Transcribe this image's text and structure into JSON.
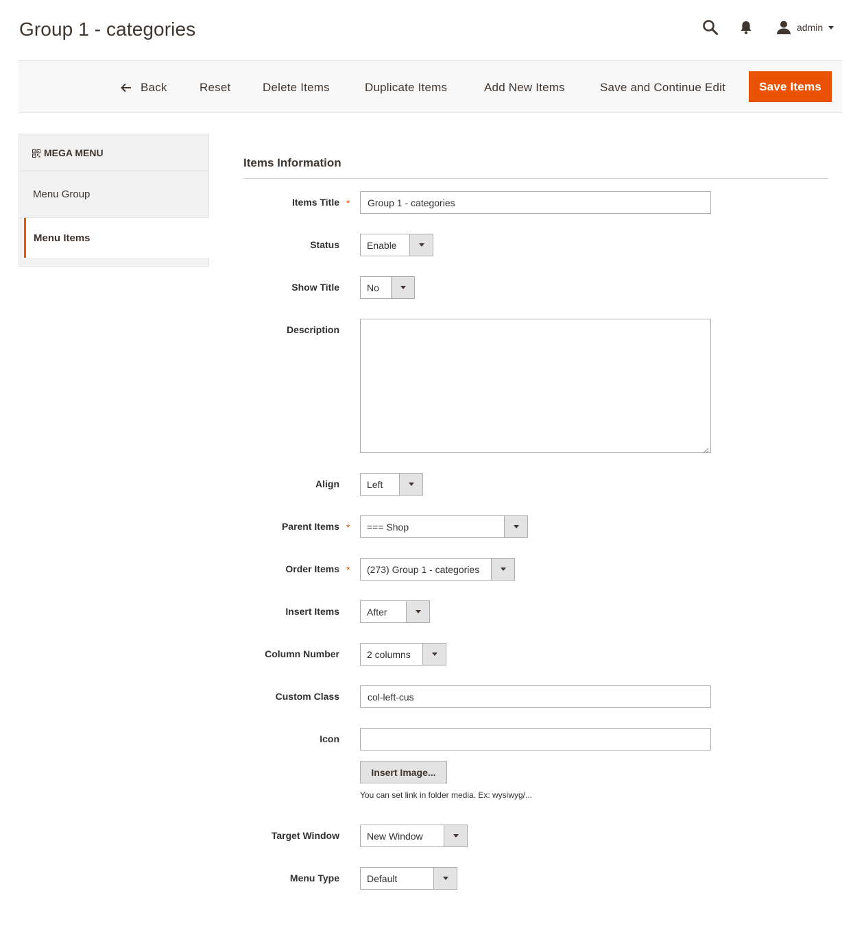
{
  "header": {
    "title": "Group 1 - categories",
    "user_name": "admin",
    "icons": {
      "search": "search-icon",
      "notifications": "bell-icon",
      "user": "user-icon"
    }
  },
  "toolbar": {
    "back_label": "Back",
    "reset_label": "Reset",
    "delete_label": "Delete Items",
    "duplicate_label": "Duplicate Items",
    "add_label": "Add New Items",
    "save_continue_label": "Save and Continue Edit",
    "save_label": "Save Items"
  },
  "sidebar": {
    "title": "MEGA MENU",
    "items": [
      {
        "label": "Menu Group",
        "active": false
      },
      {
        "label": "Menu Items",
        "active": true
      }
    ]
  },
  "form": {
    "section_title": "Items Information",
    "fields": {
      "items_title": {
        "label": "Items Title",
        "value": "Group 1 - categories",
        "required": true
      },
      "status": {
        "label": "Status",
        "value": "Enable"
      },
      "show_title": {
        "label": "Show Title",
        "value": "No"
      },
      "description": {
        "label": "Description",
        "value": ""
      },
      "align": {
        "label": "Align",
        "value": "Left"
      },
      "parent_items": {
        "label": "Parent Items",
        "value": "=== Shop",
        "required": true
      },
      "order_items": {
        "label": "Order Items",
        "value": "(273) Group 1 - categories",
        "required": true
      },
      "insert_items": {
        "label": "Insert Items",
        "value": "After"
      },
      "column_number": {
        "label": "Column Number",
        "value": "2 columns"
      },
      "custom_class": {
        "label": "Custom Class",
        "value": "col-left-cus"
      },
      "icon": {
        "label": "Icon",
        "value": "",
        "insert_button": "Insert Image...",
        "note": "You can set link in folder media. Ex: wysiwyg/..."
      },
      "target_window": {
        "label": "Target Window",
        "value": "New Window"
      },
      "menu_type": {
        "label": "Menu Type",
        "value": "Default"
      }
    },
    "required_mark": "*"
  },
  "colors": {
    "accent": "#eb5202",
    "text": "#41362f",
    "border": "#adadad"
  }
}
